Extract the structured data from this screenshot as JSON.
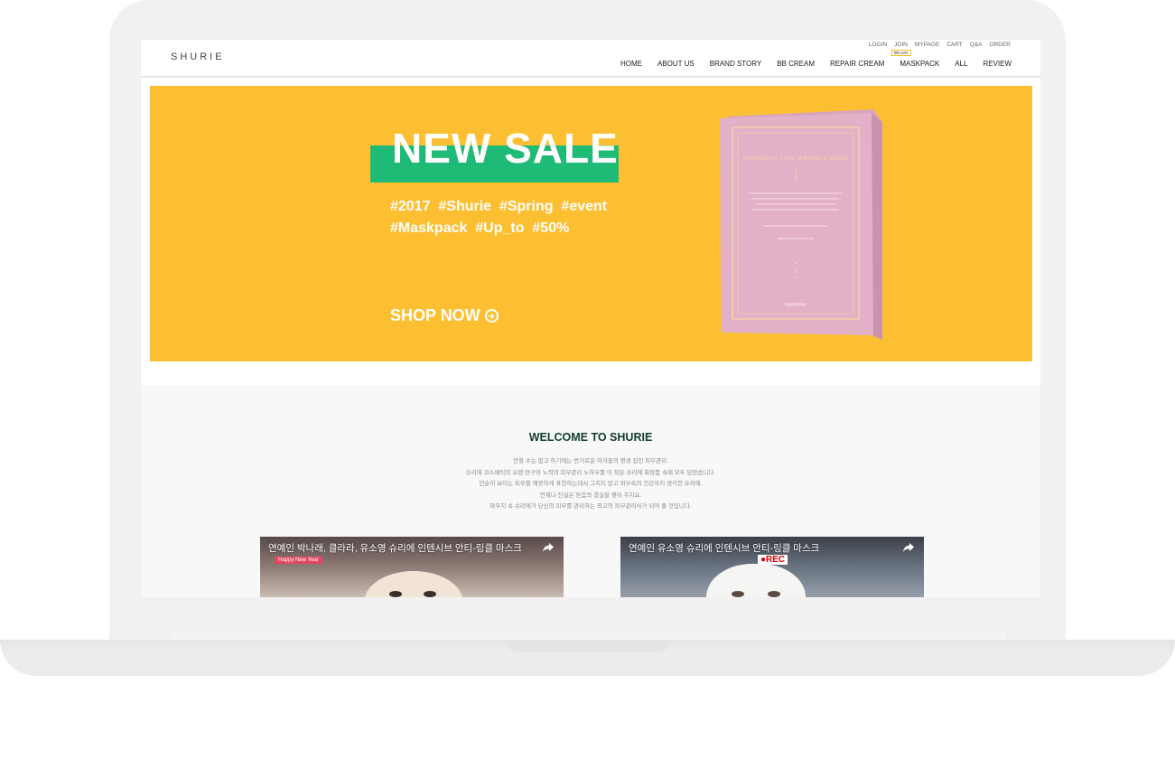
{
  "site": {
    "logo": "SHURIE"
  },
  "header": {
    "util_links": [
      "LOGIN",
      "JOIN",
      "MYPAGE",
      "CART",
      "Q&A",
      "ORDER"
    ],
    "join_badge": "₩2,500",
    "nav": [
      "HOME",
      "ABOUT US",
      "BRAND STORY",
      "BB CREAM",
      "REPAIR CREAM",
      "MASKPACK",
      "ALL",
      "REVIEW"
    ]
  },
  "hero": {
    "title": "NEW SALE",
    "hashtags_line1": "#2017  #Shurie  #Spring  #event",
    "hashtags_line2": "#Maskpack  #Up_to  #50%",
    "cta": "SHOP NOW",
    "product_label": "INTENSIVE ANTI-WRINKLE MASK",
    "colors": {
      "background": "#fdbf32",
      "accent": "#1fba75",
      "box": "#e2b1c8"
    }
  },
  "welcome": {
    "title": "WELCOME TO SHURIE",
    "lines": [
      "안할 수는 없고 하기에는 번거로운 여자들의 평생 짐인 피부관리.",
      "슈리에 코스메틱의 오랜 연구와 노력의 피부관리 노하우를 이 작은 슈리에 화장품 속에 모두 담았습니다.",
      "단순히 보이는 피부를 깨끗하게 표현하는데서 그치지 않고 피부속의 건강까지 생각한 슈리에.",
      "언제나 진실은 믿음의 결실을 맺어 주지요.",
      "파우치 속 슈리에가 당신의 피부를 관리하는 최고의 피부관리사가 되어 줄 것입니다."
    ]
  },
  "videos": [
    {
      "title": "연예인 박나래, 클라라, 유소영 슈리에 인텐시브 안티-링클 마스크",
      "overlay": "Happy New Year",
      "icon": "share-icon"
    },
    {
      "title": "연예인 유소영 슈리에 인텐시브 안티-링클 마스크",
      "overlay": "●REC",
      "icon": "share-icon"
    }
  ]
}
